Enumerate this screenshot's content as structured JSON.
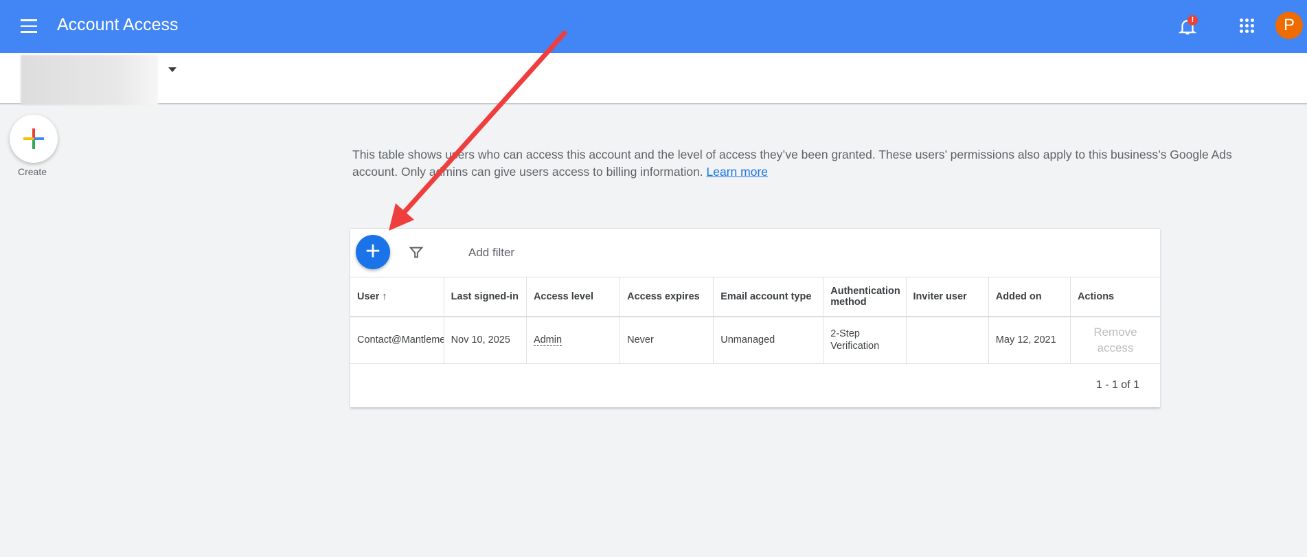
{
  "header": {
    "title": "Account Access",
    "notification_badge": "!",
    "avatar_letter": "P"
  },
  "sidebar": {
    "create_label": "Create"
  },
  "description": {
    "text": "This table shows users who can access this account and the level of access they’ve been granted. These users’ permissions also apply to this business’s Google Ads account. Only admins can give users access to billing information. ",
    "link": "Learn more"
  },
  "toolbar": {
    "add_filter": "Add filter"
  },
  "table": {
    "columns": [
      "User",
      "Last signed-in",
      "Access level",
      "Access expires",
      "Email account type",
      "Authentication method",
      "Inviter user",
      "Added on",
      "Actions"
    ],
    "rows": [
      {
        "user": "Contact@Mantlemed",
        "last_signed_in": "Nov 10, 2025",
        "access_level": "Admin",
        "access_expires": "Never",
        "email_type": "Unmanaged",
        "auth_method": "2-Step Verification",
        "inviter": "",
        "added_on": "May 12, 2021",
        "action": "Remove access"
      }
    ],
    "pagination": "1 - 1 of 1"
  },
  "colors": {
    "brand": "#4285f4",
    "fab": "#1a73e8",
    "annotation_arrow": "#ef3e3e",
    "avatar": "#ef6c00"
  }
}
